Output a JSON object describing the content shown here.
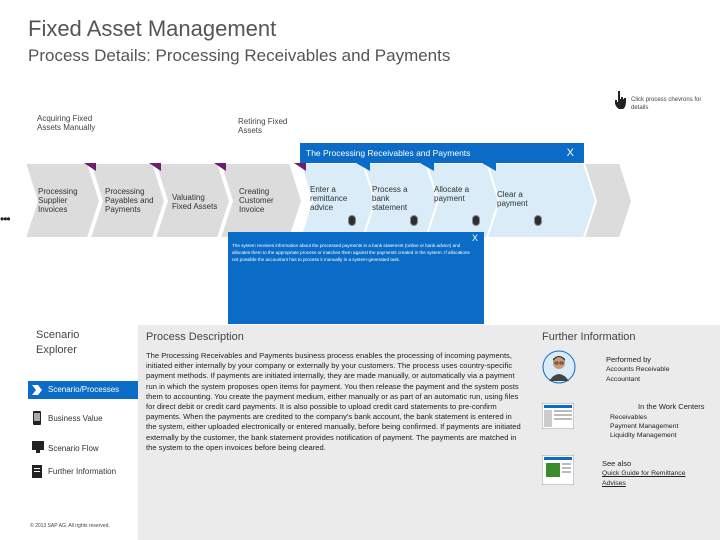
{
  "header": {
    "title": "Fixed Asset Management",
    "subtitle": "Process Details: Processing Receivables and Payments"
  },
  "hint": {
    "text": "Click process chevrons for details",
    "icon": "hand-pointer-icon"
  },
  "top_labels": {
    "acquiring": "Acquiring Fixed Assets Manually",
    "retiring": "Retiring Fixed Assets"
  },
  "banner": {
    "title": "The Processing Receivables and Payments",
    "close": "X"
  },
  "process_steps": [
    {
      "label": "Processing Supplier Invoices"
    },
    {
      "label": "Processing Payables and Payments"
    },
    {
      "label": "Valuating Fixed Assets"
    },
    {
      "label": "Creating Customer Invoice"
    },
    {
      "label": "Enter a remittance advice"
    },
    {
      "label": "Process a bank statement"
    },
    {
      "label": "Allocate a payment"
    },
    {
      "label": "Clear a payment"
    }
  ],
  "detail_popup": {
    "close": "X",
    "text": "The system receives information about the processed payments in a bank statement (online or bank advice) and allocates them to the appropriate process or matches them against the payments created in the system. If allocations not possible the accountant has to process it manually in a system-generated task."
  },
  "scenario_explorer": {
    "title": "Scenario Explorer",
    "items": [
      {
        "label": "Scenario/Processes",
        "icon": "chevron-arrow-icon",
        "active": true
      },
      {
        "label": "Business Value",
        "icon": "phone-device-icon",
        "active": false
      },
      {
        "label": "Scenario Flow",
        "icon": "monitor-icon",
        "active": false
      },
      {
        "label": "Further Information",
        "icon": "document-icon",
        "active": false
      }
    ],
    "copyright": "© 2013 SAP AG. All rights reserved."
  },
  "process_description": {
    "title": "Process Description",
    "text": "The Processing Receivables and Payments business process enables the processing of incoming payments, initiated either internally by your company or externally by your customers. The process uses country-specific payment methods. If payments are initiated internally, they are made manually, or automatically via a payment run in which the system proposes open items for payment. You then release the payment and the system posts them to accounting. You create the payment medium, either manually or as part of an automatic run, using files for direct debit or credit card payments. It is also possible to upload credit card statements to pre-confirm payments. When the payments are credited to the company's bank account, the bank statement is entered in the system, either uploaded electronically or entered manually, before being confirmed. If payments are initiated externally by the customer, the bank statement provides notification of payment. The payments are matched in the system to the open invoices before being cleared."
  },
  "further_information": {
    "title": "Further Information",
    "performed_by": {
      "head": "Performed by",
      "value": "Accounts Receivable Accountant",
      "icon": "person-avatar-icon"
    },
    "work_centers": {
      "head": "In the Work Centers",
      "items": [
        "Receivables",
        "Payment Management",
        "Liquidity Management"
      ],
      "icon": "work-center-screen-icon"
    },
    "see_also": {
      "head": "See also",
      "link": "Quick Guide for Remittance Advises",
      "icon": "quick-guide-screen-icon"
    }
  },
  "colors": {
    "accent_blue": "#0b6cc7",
    "chevron_purple": "#6b1f6e",
    "chevron_gray": "#dcdcdc",
    "chevron_light_blue": "#d9ecf8",
    "panel_gray": "#ebebeb"
  }
}
